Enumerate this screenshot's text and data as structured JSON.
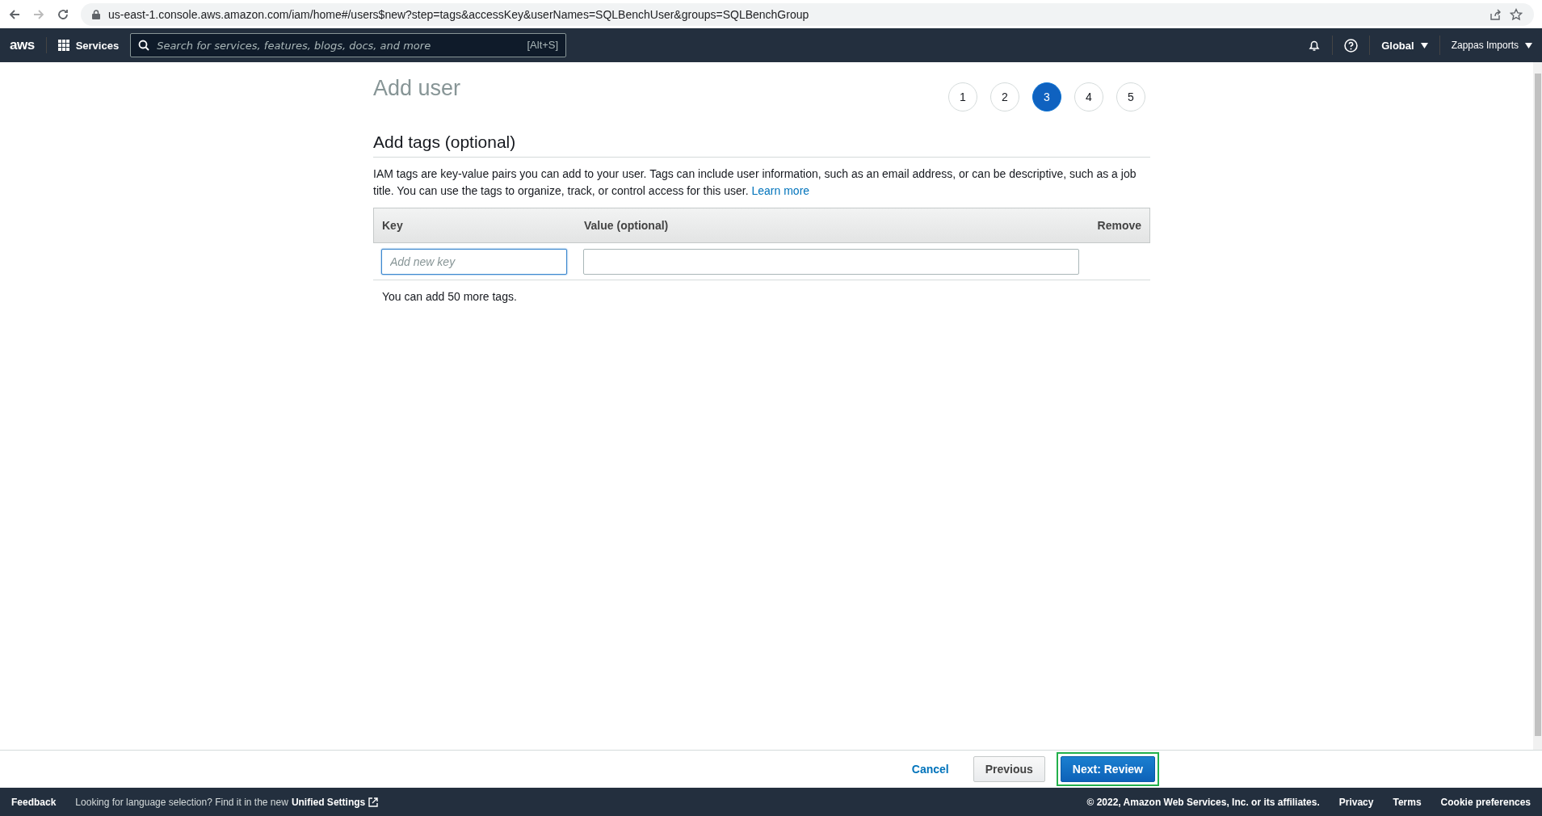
{
  "browser": {
    "url": "us-east-1.console.aws.amazon.com/iam/home#/users$new?step=tags&accessKey&userNames=SQLBenchUser&groups=SQLBenchGroup"
  },
  "nav": {
    "logo": "aws",
    "services": "Services",
    "search_placeholder": "Search for services, features, blogs, docs, and more",
    "shortcut": "[Alt+S]",
    "region": "Global",
    "account": "Zappas Imports"
  },
  "page": {
    "title": "Add user",
    "steps": [
      {
        "label": "1",
        "selected": false
      },
      {
        "label": "2",
        "selected": false
      },
      {
        "label": "3",
        "selected": true
      },
      {
        "label": "4",
        "selected": false
      },
      {
        "label": "5",
        "selected": false
      }
    ],
    "section_title": "Add tags (optional)",
    "description": "IAM tags are key-value pairs you can add to your user. Tags can include user information, such as an email address, or can be descriptive, such as a job title. You can use the tags to organize, track, or control access for this user.",
    "learn_more": "Learn more",
    "table": {
      "columns": [
        "Key",
        "Value (optional)",
        "Remove"
      ],
      "key_placeholder": "Add new key"
    },
    "note": "You can add 50 more tags."
  },
  "actions": {
    "cancel": "Cancel",
    "previous": "Previous",
    "next": "Next: Review",
    "next_highlighted": true
  },
  "footer": {
    "feedback": "Feedback",
    "language_note": "Looking for language selection? Find it in the new",
    "unified_settings": "Unified Settings",
    "copyright": "© 2022, Amazon Web Services, Inc. or its affiliates.",
    "links": [
      "Privacy",
      "Terms",
      "Cookie preferences"
    ]
  }
}
